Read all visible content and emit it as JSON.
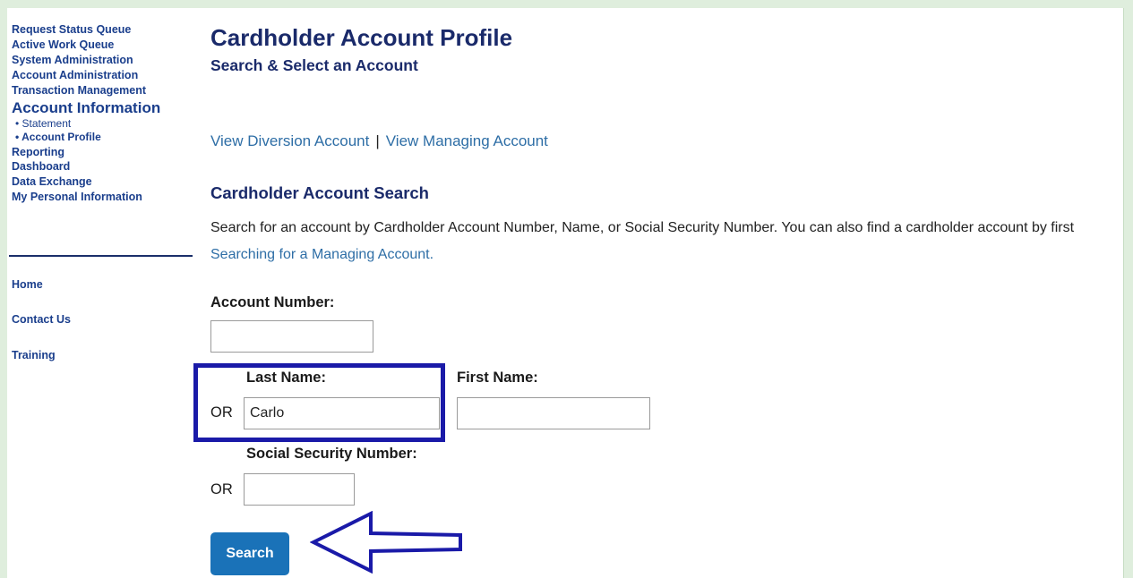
{
  "sidebar": {
    "nav_items": [
      {
        "label": "Request Status Queue"
      },
      {
        "label": "Active Work Queue"
      },
      {
        "label": "System Administration"
      },
      {
        "label": "Account Administration"
      },
      {
        "label": "Transaction Management"
      }
    ],
    "section_title": "Account Information",
    "section_items": [
      {
        "label": "• Statement"
      },
      {
        "label": "• Account Profile"
      }
    ],
    "nav_items_after": [
      {
        "label": "Reporting"
      },
      {
        "label": "Dashboard"
      },
      {
        "label": "Data Exchange"
      },
      {
        "label": "My Personal Information"
      }
    ],
    "extra_links": [
      {
        "label": "Home"
      },
      {
        "label": "Contact Us"
      },
      {
        "label": "Training"
      }
    ]
  },
  "main": {
    "title": "Cardholder Account Profile",
    "subtitle": "Search & Select an Account",
    "top_links": {
      "diversion": "View Diversion Account",
      "separator": "|",
      "managing": "View Managing Account"
    },
    "search_heading": "Cardholder Account Search",
    "description_text": "Search for an account by Cardholder Account Number, Name, or Social Security Number. You can also find a cardholder account by first ",
    "description_link": "Searching for a Managing Account.",
    "form": {
      "account_number_label": "Account Number:",
      "account_number_value": "",
      "or_label": "OR",
      "last_name_label": "Last Name:",
      "last_name_value": "Carlo",
      "first_name_label": "First Name:",
      "first_name_value": "",
      "ssn_label": "Social Security Number:",
      "ssn_value": "",
      "search_button": "Search"
    }
  },
  "annotations": {
    "highlight_color": "#1a1aa8",
    "arrow_icon": "left-arrow-icon"
  }
}
